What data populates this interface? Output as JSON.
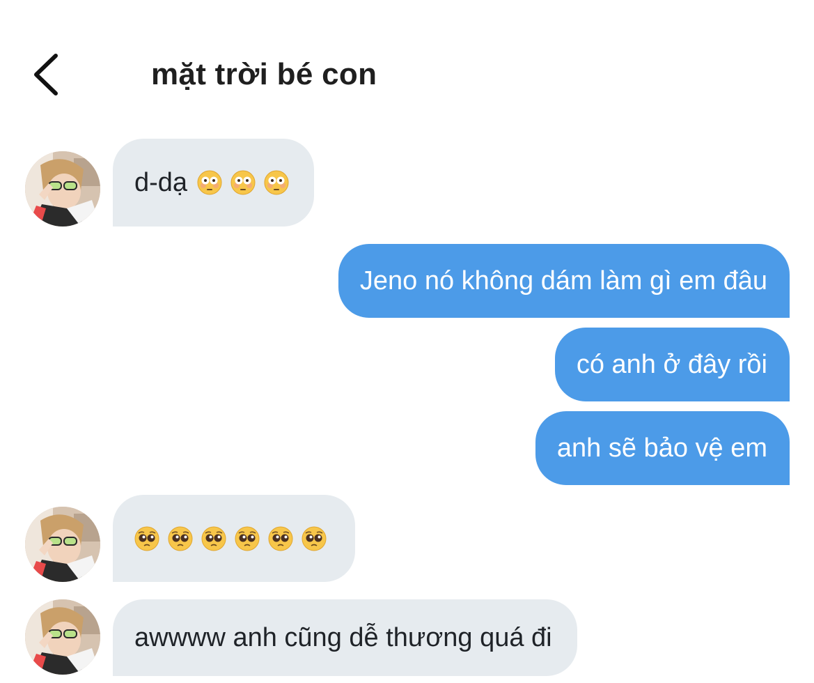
{
  "header": {
    "title": "mặt trời bé con",
    "back_icon": "chevron-left-icon"
  },
  "messages": [
    {
      "side": "in",
      "text": "d-dạ",
      "emoji": "flushed-face",
      "emoji_count": 3
    },
    {
      "side": "out",
      "text": "Jeno nó không dám làm gì em đâu"
    },
    {
      "side": "out",
      "text": "có anh ở đây rồi"
    },
    {
      "side": "out",
      "text": "anh sẽ bảo vệ em"
    },
    {
      "side": "in",
      "emoji": "pleading-face",
      "emoji_count": 6
    },
    {
      "side": "in",
      "text": "awwww anh cũng dễ thương quá đi"
    }
  ],
  "colors": {
    "incoming_bubble": "#e6ebef",
    "outgoing_bubble": "#4c9be8",
    "text_dark": "#1f2328",
    "text_light": "#ffffff"
  }
}
